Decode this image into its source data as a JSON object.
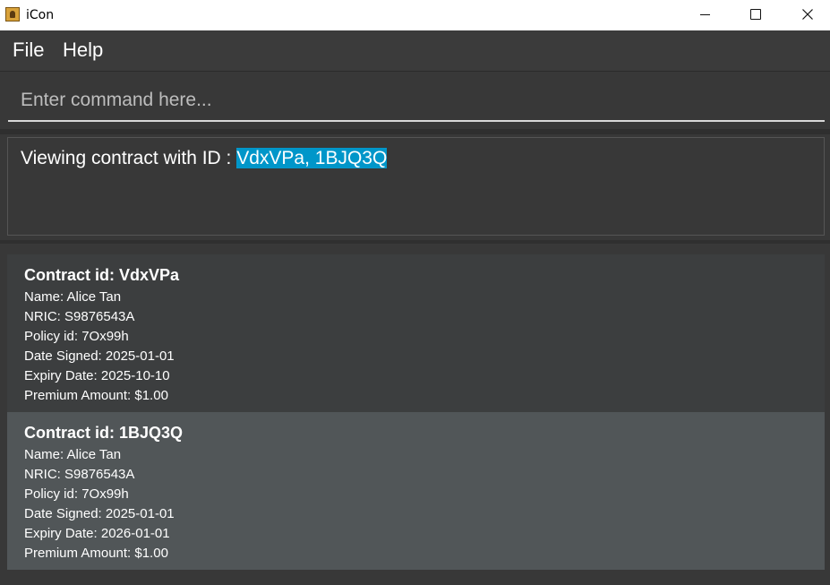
{
  "window": {
    "title": "iCon",
    "icon": "app-icon"
  },
  "menu": {
    "items": [
      "File",
      "Help"
    ]
  },
  "command": {
    "value": "",
    "placeholder": "Enter command here..."
  },
  "result": {
    "prefix": "Viewing contract with ID : ",
    "highlight": "VdxVPa, 1BJQ3Q",
    "highlight_color": "#0096c9"
  },
  "contracts": [
    {
      "title": "Contract id: VdxVPa",
      "name": "Name: Alice Tan",
      "nric": "NRIC: S9876543A",
      "policy": "Policy id: 7Ox99h",
      "signed": "Date Signed: 2025-01-01",
      "expiry": "Expiry Date: 2025-10-10",
      "premium": "Premium Amount: $1.00"
    },
    {
      "title": "Contract id: 1BJQ3Q",
      "name": "Name: Alice Tan",
      "nric": "NRIC: S9876543A",
      "policy": "Policy id: 7Ox99h",
      "signed": "Date Signed: 2025-01-01",
      "expiry": "Expiry Date: 2026-01-01",
      "premium": "Premium Amount: $1.00"
    }
  ],
  "colors": {
    "background": "#383838",
    "card": "#3c3e3f",
    "card_selected": "#515658",
    "accent": "#0096c9"
  }
}
